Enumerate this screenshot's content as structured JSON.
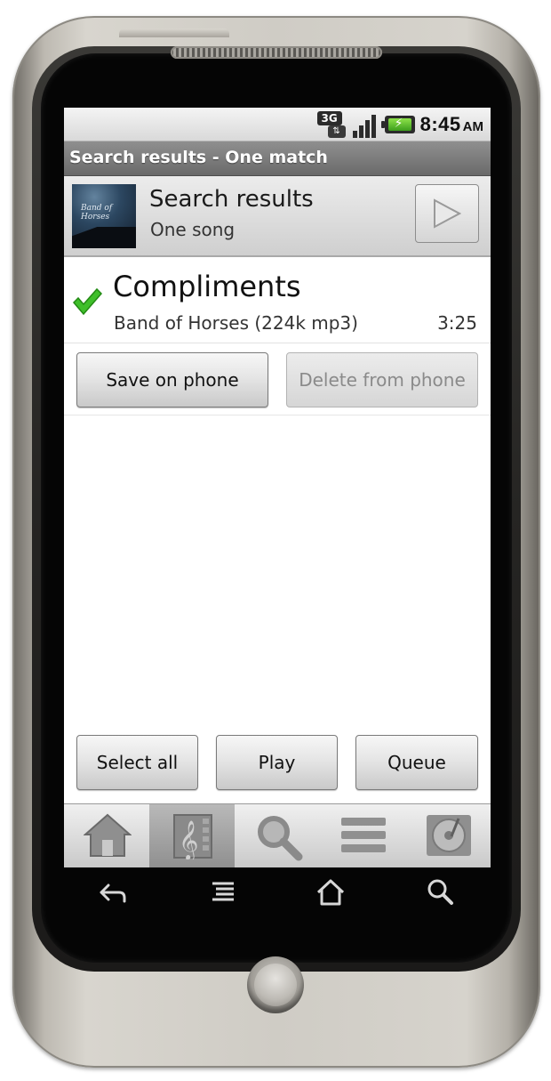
{
  "status_bar": {
    "network": "3G",
    "time": "8:45",
    "ampm": "AM"
  },
  "title_bar": {
    "title": "Search results - One match"
  },
  "header": {
    "album_art_text": "Band of Horses",
    "title": "Search results",
    "subtitle": "One song",
    "play_icon": "play-icon"
  },
  "song": {
    "status_icon": "checkmark-icon",
    "title": "Compliments",
    "meta": "Band of Horses (224k mp3)",
    "duration": "3:25"
  },
  "actions": {
    "save_label": "Save on phone",
    "delete_label": "Delete from phone"
  },
  "bottom_actions": {
    "select_all_label": "Select all",
    "play_label": "Play",
    "queue_label": "Queue"
  },
  "tabs": [
    {
      "icon": "home-icon",
      "active": false
    },
    {
      "icon": "music-library-icon",
      "active": true
    },
    {
      "icon": "search-icon",
      "active": false
    },
    {
      "icon": "list-icon",
      "active": false
    },
    {
      "icon": "now-playing-icon",
      "active": false
    }
  ],
  "soft_keys": [
    "back-icon",
    "menu-icon",
    "home-icon",
    "search-icon"
  ],
  "colors": {
    "checkmark": "#3fbf2a",
    "title_bar": "#7a7a7a",
    "active_tab": "#a5a5a5"
  }
}
